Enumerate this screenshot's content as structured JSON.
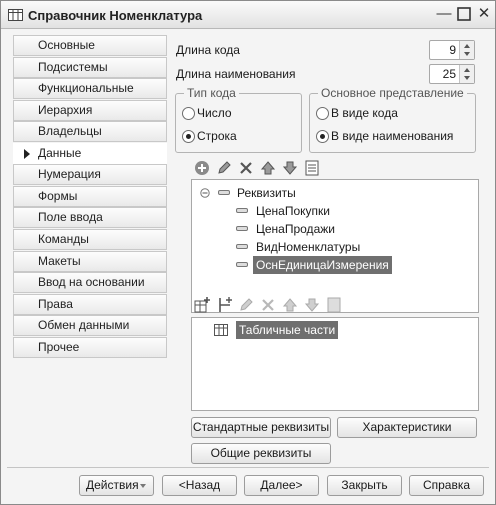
{
  "window": {
    "title": "Справочник Номенклатура"
  },
  "nav": {
    "items": [
      "Основные",
      "Подсистемы",
      "Функциональные опции",
      "Иерархия",
      "Владельцы",
      "Данные",
      "Нумерация",
      "Формы",
      "Поле ввода",
      "Команды",
      "Макеты",
      "Ввод на основании",
      "Права",
      "Обмен данными",
      "Прочее"
    ],
    "active": "Данные"
  },
  "code_length": {
    "label": "Длина кода",
    "value": "9"
  },
  "name_length": {
    "label": "Длина наименования",
    "value": "25"
  },
  "code_type": {
    "title": "Тип кода",
    "options": [
      "Число",
      "Строка"
    ],
    "selected": "Строка"
  },
  "main_representation": {
    "title": "Основное представление",
    "options": [
      "В виде кода",
      "В виде наименования"
    ],
    "selected": "В виде наименования"
  },
  "attributes_tree": {
    "root": "Реквизиты",
    "items": [
      "ЦенаПокупки",
      "ЦенаПродажи",
      "ВидНоменклатуры",
      "ОснЕдиницаИзмерения"
    ],
    "selected": "ОснЕдиницаИзмерения"
  },
  "tabular_tree": {
    "root": "Табличные части"
  },
  "panel_buttons": {
    "standard": "Стандартные реквизиты",
    "characteristics": "Характеристики",
    "common": "Общие реквизиты"
  },
  "footer": {
    "actions": "Действия",
    "back": "<Назад",
    "next": "Далее>",
    "close": "Закрыть",
    "help": "Справка"
  }
}
